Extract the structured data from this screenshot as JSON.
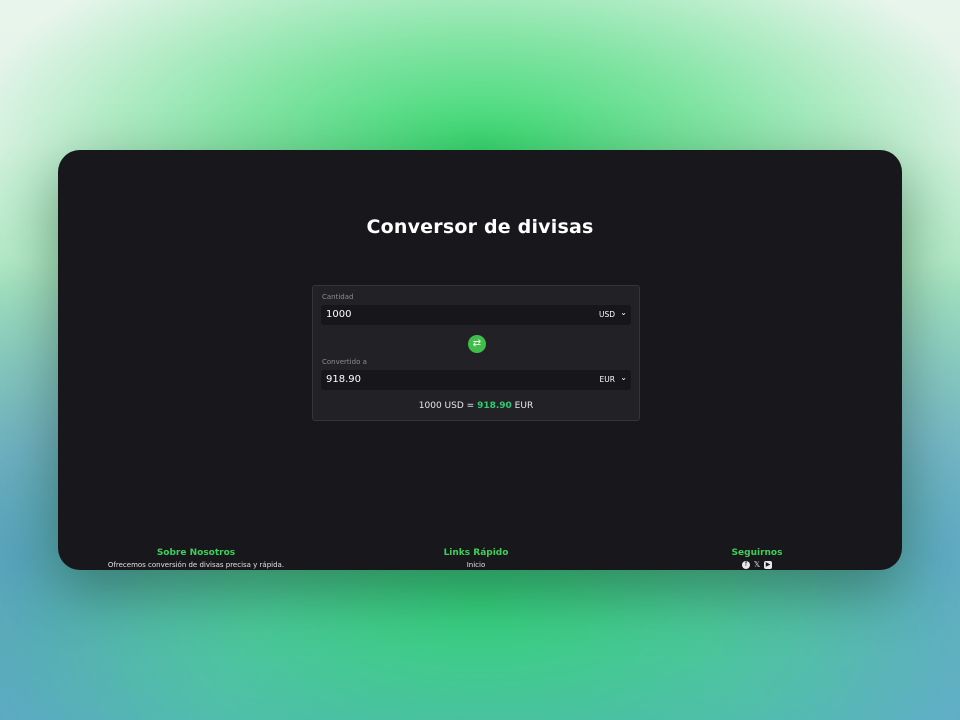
{
  "app": {
    "title": "Conversor de divisas"
  },
  "converter": {
    "amount_label": "Cantidad",
    "amount_value": "1000",
    "from_currency": "USD",
    "converted_label": "Convertido a",
    "converted_value": "918.90",
    "to_currency": "EUR",
    "swap_icon": "swap-arrows-icon",
    "result": {
      "left": "1000 USD =",
      "value": "918.90",
      "right": "EUR"
    }
  },
  "footer": {
    "about": {
      "heading": "Sobre Nosotros",
      "text": "Ofrecemos conversión de divisas precisa y rápida."
    },
    "links": {
      "heading": "Links Rápido",
      "items": [
        "Inicio"
      ]
    },
    "social": {
      "heading": "Seguirnos",
      "icons": [
        "facebook-icon",
        "x-icon",
        "youtube-icon"
      ]
    }
  },
  "colors": {
    "accent": "#3fbf4a",
    "highlight": "#2ecc71",
    "panel": "#18181c"
  }
}
